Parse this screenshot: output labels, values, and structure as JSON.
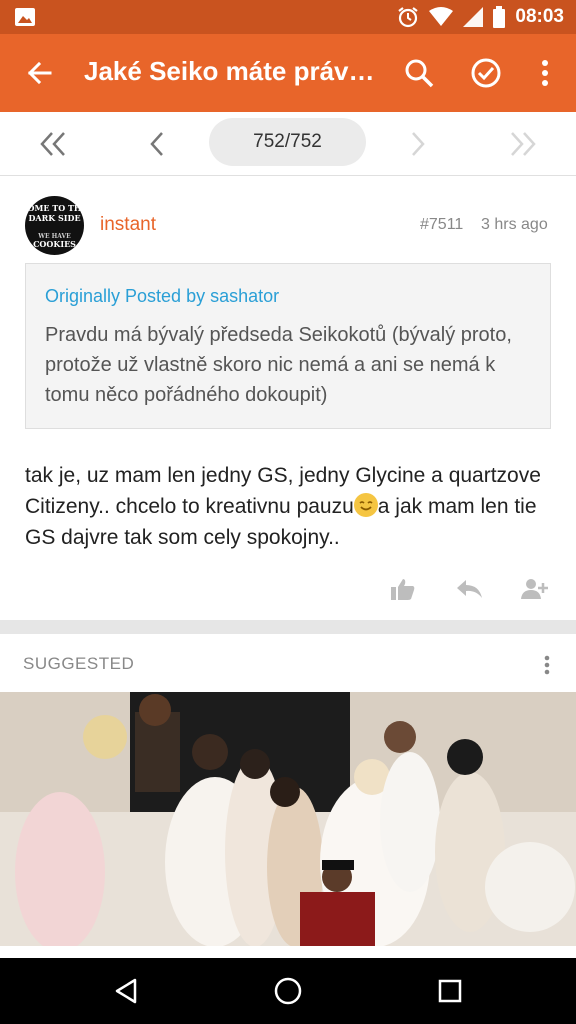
{
  "status_bar": {
    "time": "08:03"
  },
  "app_bar": {
    "title": "Jaké Seiko máte práv…"
  },
  "pager": {
    "page_indicator": "752/752"
  },
  "post": {
    "author": "instant",
    "number": "#7511",
    "time": "3 hrs ago",
    "avatar_lines": [
      "OME TO TH",
      "DARK SIDE",
      "WE HAVE",
      "COOKIES"
    ],
    "quote": {
      "header": "Originally Posted by sashator",
      "text": "Pravdu má bývalý předseda Seikokotů (bývalý proto, protože už vlastně skoro nic nemá a ani se nemá k tomu něco pořádného dokoupit)"
    },
    "body_before_emoji": "tak je, uz mam len jedny GS, jedny Glycine a quartzove Citizeny.. chcelo to kreativnu pauzu",
    "body_after_emoji": "a jak mam len tie GS dajvre tak som cely spokojny.."
  },
  "suggested": {
    "label": "SUGGESTED"
  },
  "colors": {
    "accent": "#e8652a",
    "status_bar": "#c9531f",
    "link": "#2a9fd6"
  }
}
